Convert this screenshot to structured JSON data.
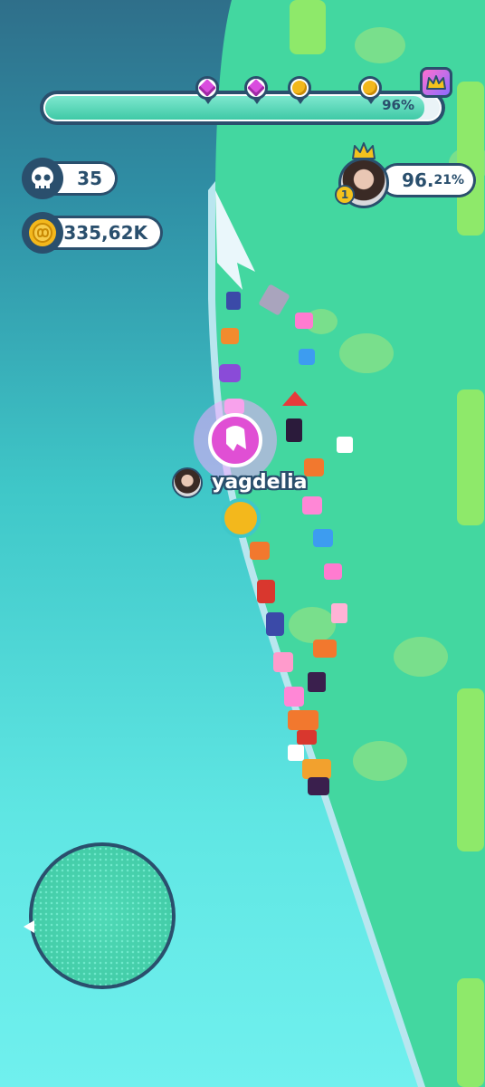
{
  "hud": {
    "progress": {
      "percent_label": "96%",
      "fill": 0.96
    },
    "milestones": [
      "gem-icon",
      "gem-icon",
      "coin-icon",
      "coin-icon"
    ],
    "crown_reward": "crown-icon",
    "kills": "35",
    "coins": "335,62K",
    "leader": {
      "rank": "1",
      "percent_main": "96.",
      "percent_decimal": "21%"
    },
    "player": {
      "name": "yagdelia"
    }
  },
  "colors": {
    "outline": "#2a4f6d",
    "land": "#43d7a0",
    "water": "#4fd9e0",
    "accent_pink": "#d94cde",
    "coin": "#f3b81c"
  }
}
